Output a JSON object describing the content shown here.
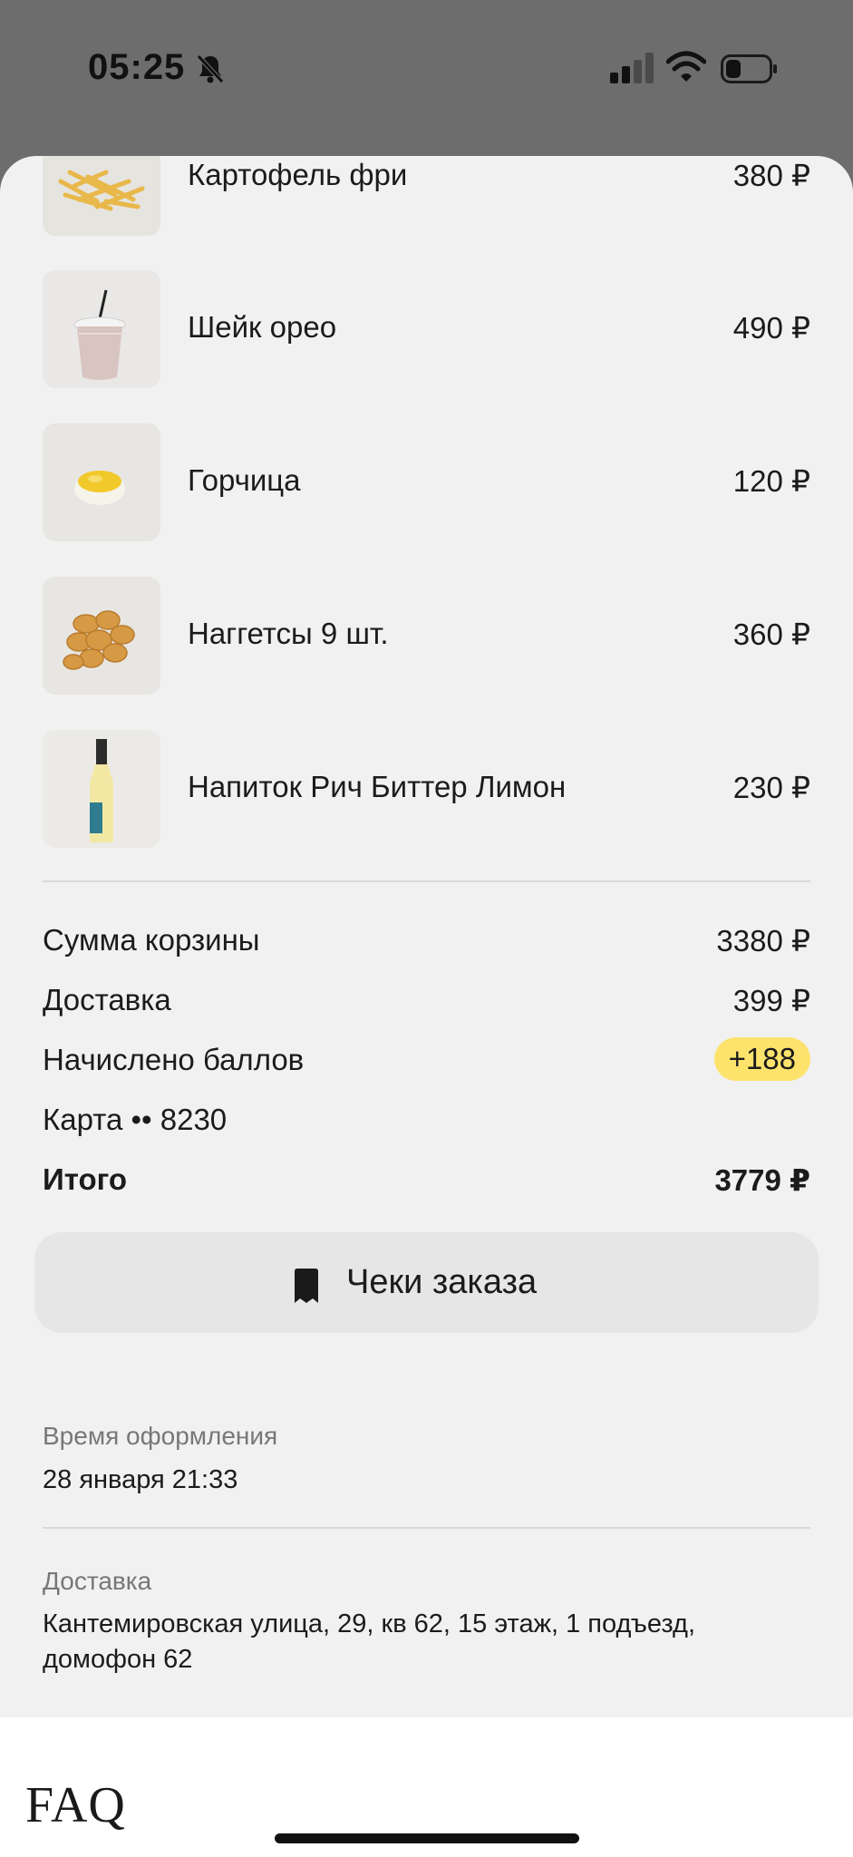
{
  "status_bar": {
    "time": "05:25"
  },
  "items": [
    {
      "name": "Картофель фри",
      "price": "380 ₽"
    },
    {
      "name": "Шейк орео",
      "price": "490 ₽"
    },
    {
      "name": "Горчица",
      "price": "120 ₽"
    },
    {
      "name": "Наггетсы 9 шт.",
      "price": "360 ₽"
    },
    {
      "name": "Напиток Рич Биттер Лимон",
      "price": "230 ₽"
    }
  ],
  "summary": {
    "basket_label": "Сумма корзины",
    "basket_value": "3380 ₽",
    "delivery_label": "Доставка",
    "delivery_value": "399 ₽",
    "points_label": "Начислено баллов",
    "points_value": "+188",
    "card_label": "Карта •• 8230",
    "total_label": "Итого",
    "total_value": "3779 ₽"
  },
  "receipt_button": {
    "label": "Чеки заказа"
  },
  "order_time": {
    "label": "Время оформления",
    "value": "28 января 21:33"
  },
  "delivery_address": {
    "label": "Доставка",
    "line1": "Кантемировская улица, 29, кв 62, 15 этаж, 1 подъезд,",
    "line2": "домофон 62"
  },
  "footer": {
    "logo": "FAQ"
  },
  "colors": {
    "badge": "#fde36c",
    "sheet": "#f1f1f1",
    "overlay": "#6d6d6d"
  }
}
